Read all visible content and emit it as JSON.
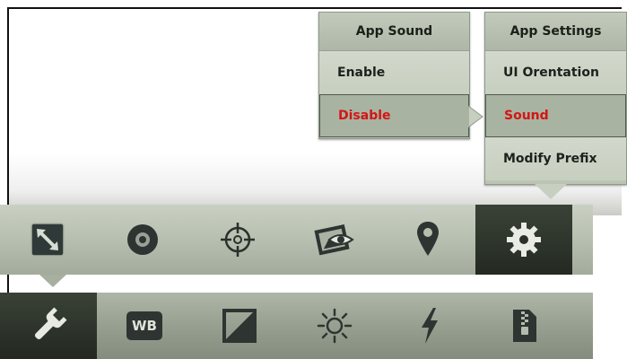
{
  "menus": {
    "app_sound": {
      "title": "App Sound",
      "items": [
        "Enable",
        "Disable"
      ],
      "selected": "Disable"
    },
    "app_settings": {
      "title": "App Settings",
      "items": [
        "UI Orentation",
        "Sound",
        "Modify Prefix"
      ],
      "selected": "Sound"
    }
  },
  "toolbar_top": {
    "icons": [
      "resize-arrows-icon",
      "disc-icon",
      "crosshair-icon",
      "image-eye-icon",
      "location-pin-icon",
      "gear-icon"
    ],
    "active": "gear-icon"
  },
  "toolbar_bottom": {
    "icons": [
      "wrench-icon",
      "wb-icon",
      "exposure-icon",
      "brightness-icon",
      "flash-icon",
      "zip-file-icon"
    ],
    "wb_label": "WB",
    "active": "wrench-icon"
  },
  "colors": {
    "highlight_text": "#d31515",
    "menu_bg": "#c7cfc0",
    "toolbar_active": "#2b3027"
  }
}
